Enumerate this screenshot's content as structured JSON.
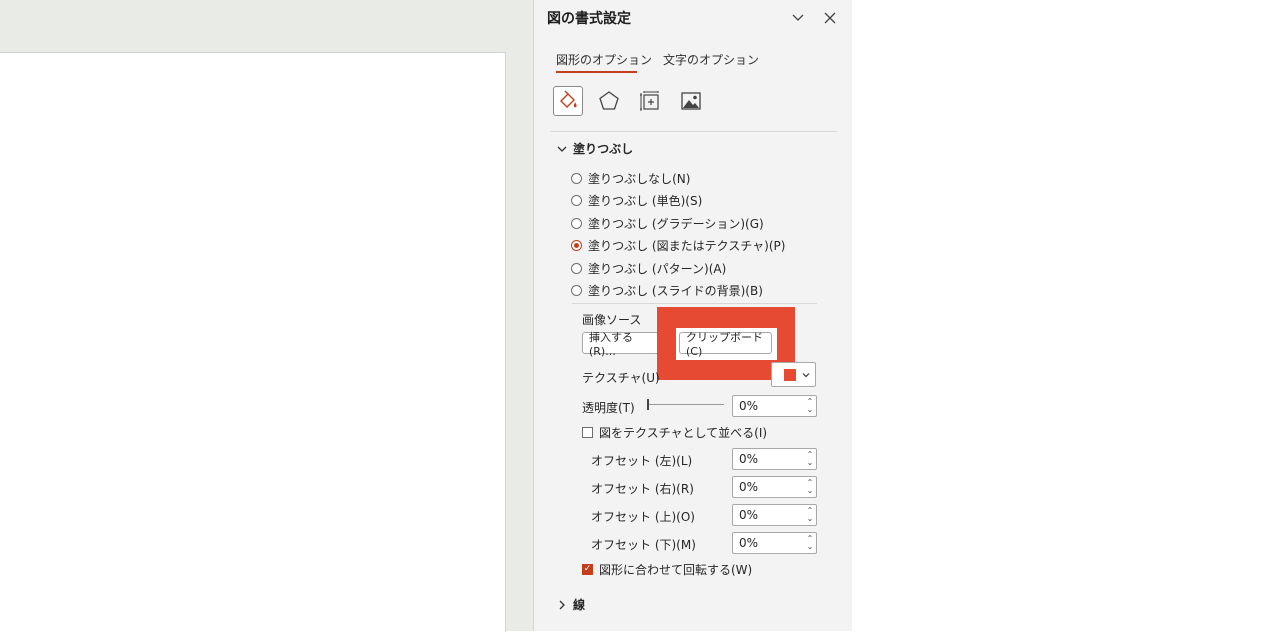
{
  "pane": {
    "title": "図の書式設定",
    "tabs": [
      {
        "label": "図形のオプション",
        "active": true
      },
      {
        "label": "文字のオプション",
        "active": false
      }
    ],
    "icon_tabs": [
      "fill-line-icon",
      "effects-pentagon-icon",
      "size-properties-icon",
      "picture-icon"
    ],
    "fill_section": {
      "header": "塗りつぶし",
      "options": [
        {
          "label": "塗りつぶしなし(N)",
          "selected": false
        },
        {
          "label": "塗りつぶし (単色)(S)",
          "selected": false
        },
        {
          "label": "塗りつぶし (グラデーション)(G)",
          "selected": false
        },
        {
          "label": "塗りつぶし (図またはテクスチャ)(P)",
          "selected": true
        },
        {
          "label": "塗りつぶし (パターン)(A)",
          "selected": false
        },
        {
          "label": "塗りつぶし (スライドの背景)(B)",
          "selected": false
        }
      ],
      "image_source_label": "画像ソース",
      "insert_button": "挿入する(R)...",
      "clipboard_button": "クリップボード(C)",
      "texture_label": "テクスチャ(U)",
      "transparency_label": "透明度(T)",
      "transparency_value": "0%",
      "tile_checkbox_label": "図をテクスチャとして並べる(I)",
      "tile_checked": false,
      "offsets": [
        {
          "label": "オフセット (左)(L)",
          "value": "0%"
        },
        {
          "label": "オフセット (右)(R)",
          "value": "0%"
        },
        {
          "label": "オフセット (上)(O)",
          "value": "0%"
        },
        {
          "label": "オフセット (下)(M)",
          "value": "0%"
        }
      ],
      "rotate_checkbox_label": "図形に合わせて回転する(W)",
      "rotate_checked": true
    },
    "line_section": {
      "header": "線"
    }
  },
  "colors": {
    "accent": "#c43e1c",
    "highlight": "#e64a33",
    "pane_bg": "#f3f3f3",
    "workspace_bg": "#e9ebe6"
  }
}
